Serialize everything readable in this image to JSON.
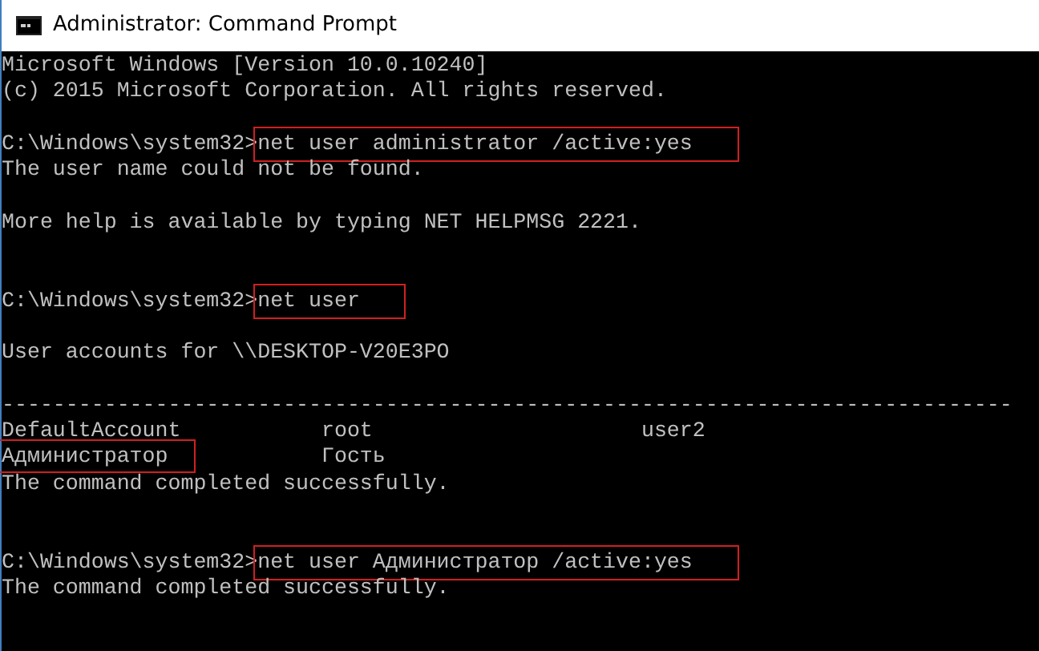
{
  "window": {
    "title": "Administrator: Command Prompt"
  },
  "console": {
    "lines": [
      {
        "kind": "text",
        "text": "Microsoft Windows [Version 10.0.10240]"
      },
      {
        "kind": "text",
        "text": "(c) 2015 Microsoft Corporation. All rights reserved."
      },
      {
        "kind": "blank"
      },
      {
        "kind": "command",
        "prompt": "C:\\Windows\\system32>",
        "command": "net user administrator /active:yes",
        "highlighted": true
      },
      {
        "kind": "text",
        "text": "The user name could not be found."
      },
      {
        "kind": "blank"
      },
      {
        "kind": "text",
        "text": "More help is available by typing NET HELPMSG 2221."
      },
      {
        "kind": "blank"
      },
      {
        "kind": "blank"
      },
      {
        "kind": "command",
        "prompt": "C:\\Windows\\system32>",
        "command": "net user",
        "highlighted": true
      },
      {
        "kind": "blank"
      },
      {
        "kind": "text",
        "text": "User accounts for \\\\DESKTOP-V20E3PO"
      },
      {
        "kind": "blank"
      },
      {
        "kind": "text",
        "text": "-------------------------------------------------------------------------------"
      },
      {
        "kind": "columns",
        "cells": [
          {
            "text": "DefaultAccount",
            "highlighted": false
          },
          {
            "text": "root",
            "highlighted": false
          },
          {
            "text": "user2",
            "highlighted": false
          }
        ]
      },
      {
        "kind": "columns",
        "cells": [
          {
            "text": "Администратор",
            "highlighted": true
          },
          {
            "text": "Гость",
            "highlighted": false
          }
        ]
      },
      {
        "kind": "text",
        "text": "The command completed successfully."
      },
      {
        "kind": "blank"
      },
      {
        "kind": "blank"
      },
      {
        "kind": "command",
        "prompt": "C:\\Windows\\system32>",
        "command": "net user Администратор /active:yes",
        "highlighted": true
      },
      {
        "kind": "text",
        "text": "The command completed successfully."
      }
    ]
  }
}
